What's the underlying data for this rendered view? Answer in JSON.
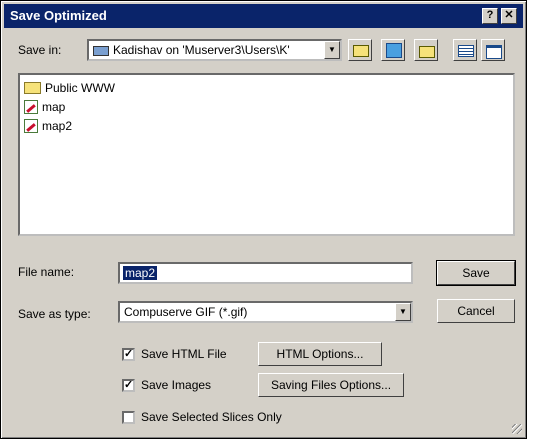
{
  "window": {
    "title": "Save Optimized",
    "help_btn": "?",
    "close_btn": "✕"
  },
  "save_in": {
    "label": "Save in:",
    "value": "Kadishav on 'Muserver3\\Users\\K'"
  },
  "files": [
    {
      "name": "Public WWW",
      "type": "folder"
    },
    {
      "name": "map",
      "type": "file"
    },
    {
      "name": "map2",
      "type": "file"
    }
  ],
  "file_name": {
    "label": "File name:",
    "value": "map2"
  },
  "save_as_type": {
    "label": "Save as type:",
    "value": "Compuserve GIF (*.gif)"
  },
  "buttons": {
    "save": "Save",
    "cancel": "Cancel",
    "html_options": "HTML Options...",
    "saving_files_options": "Saving Files Options..."
  },
  "checkboxes": {
    "save_html": {
      "label": "Save HTML File",
      "checked": true
    },
    "save_images": {
      "label": "Save Images",
      "checked": true
    },
    "save_selected": {
      "label": "Save Selected Slices Only",
      "checked": false
    }
  }
}
